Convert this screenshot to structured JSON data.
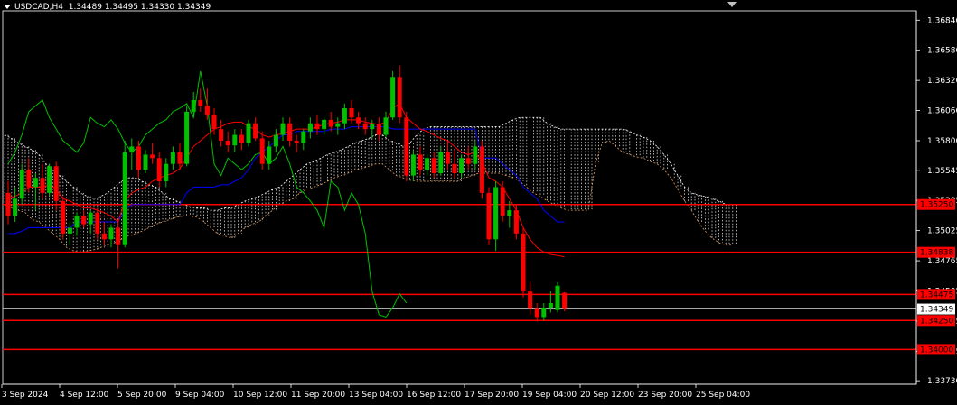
{
  "chart_data": {
    "type": "candlestick",
    "symbol": "USDCAD",
    "timeframe": "H4",
    "ohlc_header": {
      "open": "1.34489",
      "high": "1.34495",
      "low": "1.34330",
      "close": "1.34349"
    },
    "current_price": "1.34349",
    "y_ticks": [
      "1.36840",
      "1.36580",
      "1.36320",
      "1.36060",
      "1.35800",
      "1.35545",
      "1.35285",
      "1.35025",
      "1.34765",
      "1.34505",
      "1.34245",
      "1.33985",
      "1.33730"
    ],
    "ylim": [
      1.337,
      1.3692
    ],
    "x_ticks": [
      "3 Sep 2024",
      "4 Sep 12:00",
      "5 Sep 20:00",
      "9 Sep 04:00",
      "10 Sep 12:00",
      "11 Sep 20:00",
      "13 Sep 04:00",
      "16 Sep 12:00",
      "17 Sep 20:00",
      "19 Sep 04:00",
      "20 Sep 12:00",
      "23 Sep 20:00",
      "25 Sep 04:00"
    ],
    "horizontal_levels": [
      {
        "value": 1.3525,
        "label": "1.35250",
        "color": "#ff0000"
      },
      {
        "value": 1.34838,
        "label": "1.34838",
        "color": "#ff0000"
      },
      {
        "value": 1.34475,
        "label": "1.34475",
        "color": "#ff0000"
      },
      {
        "value": 1.3425,
        "label": "1.34250",
        "color": "#ff0000"
      },
      {
        "value": 1.34,
        "label": "1.34000",
        "color": "#ff0000"
      }
    ],
    "colors": {
      "bull": "#00c000",
      "bear": "#ff0000",
      "tenkan": "#ff0000",
      "kijun": "#0000ff",
      "chikou": "#00c000",
      "cloud_a": "#ffffff",
      "cloud_b": "#e39b5b",
      "grid_axis": "#ffffff"
    },
    "candles": [
      [
        1.3535,
        1.3545,
        1.3508,
        1.3515
      ],
      [
        1.3515,
        1.354,
        1.351,
        1.353
      ],
      [
        1.353,
        1.356,
        1.3525,
        1.3555
      ],
      [
        1.3555,
        1.3565,
        1.3535,
        1.354
      ],
      [
        1.354,
        1.3552,
        1.352,
        1.3548
      ],
      [
        1.3548,
        1.356,
        1.353,
        1.3535
      ],
      [
        1.3535,
        1.356,
        1.3532,
        1.3558
      ],
      [
        1.3558,
        1.3562,
        1.352,
        1.3528
      ],
      [
        1.3528,
        1.3532,
        1.3495,
        1.35
      ],
      [
        1.35,
        1.351,
        1.349,
        1.3505
      ],
      [
        1.3505,
        1.3518,
        1.3498,
        1.3515
      ],
      [
        1.3515,
        1.352,
        1.3505,
        1.3508
      ],
      [
        1.3508,
        1.352,
        1.35,
        1.3518
      ],
      [
        1.3518,
        1.3522,
        1.3495,
        1.35
      ],
      [
        1.35,
        1.351,
        1.349,
        1.3495
      ],
      [
        1.3495,
        1.3508,
        1.3488,
        1.3505
      ],
      [
        1.3505,
        1.3512,
        1.347,
        1.349
      ],
      [
        1.349,
        1.358,
        1.3488,
        1.357
      ],
      [
        1.357,
        1.3582,
        1.3555,
        1.3575
      ],
      [
        1.3575,
        1.358,
        1.3548,
        1.3555
      ],
      [
        1.3555,
        1.3572,
        1.3552,
        1.3568
      ],
      [
        1.3568,
        1.3578,
        1.356,
        1.3565
      ],
      [
        1.3565,
        1.357,
        1.354,
        1.3545
      ],
      [
        1.3545,
        1.3565,
        1.354,
        1.356
      ],
      [
        1.356,
        1.3575,
        1.3555,
        1.357
      ],
      [
        1.357,
        1.3578,
        1.3555,
        1.356
      ],
      [
        1.356,
        1.361,
        1.3558,
        1.3605
      ],
      [
        1.3605,
        1.3622,
        1.36,
        1.3615
      ],
      [
        1.3615,
        1.3625,
        1.3605,
        1.361
      ],
      [
        1.361,
        1.3625,
        1.3598,
        1.3602
      ],
      [
        1.3602,
        1.3608,
        1.3585,
        1.359
      ],
      [
        1.359,
        1.3598,
        1.3575,
        1.358
      ],
      [
        1.358,
        1.3588,
        1.357,
        1.3576
      ],
      [
        1.3576,
        1.359,
        1.357,
        1.3585
      ],
      [
        1.3585,
        1.359,
        1.3572,
        1.3578
      ],
      [
        1.3578,
        1.3598,
        1.3575,
        1.3595
      ],
      [
        1.3595,
        1.36,
        1.358,
        1.3582
      ],
      [
        1.3582,
        1.3588,
        1.3555,
        1.356
      ],
      [
        1.356,
        1.358,
        1.3555,
        1.3575
      ],
      [
        1.3575,
        1.359,
        1.357,
        1.3585
      ],
      [
        1.3585,
        1.36,
        1.358,
        1.3595
      ],
      [
        1.3595,
        1.36,
        1.3575,
        1.358
      ],
      [
        1.358,
        1.3585,
        1.357,
        1.3578
      ],
      [
        1.3578,
        1.359,
        1.3572,
        1.3588
      ],
      [
        1.3588,
        1.36,
        1.3582,
        1.3595
      ],
      [
        1.3595,
        1.3602,
        1.3585,
        1.359
      ],
      [
        1.359,
        1.36,
        1.3585,
        1.3598
      ],
      [
        1.3598,
        1.3605,
        1.3588,
        1.3592
      ],
      [
        1.3592,
        1.36,
        1.3585,
        1.3595
      ],
      [
        1.3595,
        1.3612,
        1.359,
        1.3608
      ],
      [
        1.3608,
        1.3615,
        1.3595,
        1.36
      ],
      [
        1.36,
        1.3605,
        1.359,
        1.3595
      ],
      [
        1.3595,
        1.36,
        1.3585,
        1.359
      ],
      [
        1.359,
        1.3598,
        1.3582,
        1.3594
      ],
      [
        1.3594,
        1.36,
        1.358,
        1.3585
      ],
      [
        1.3585,
        1.3605,
        1.3583,
        1.36
      ],
      [
        1.36,
        1.364,
        1.3598,
        1.3635
      ],
      [
        1.3635,
        1.3645,
        1.3595,
        1.36
      ],
      [
        1.36,
        1.3605,
        1.3545,
        1.355
      ],
      [
        1.355,
        1.3572,
        1.3545,
        1.3568
      ],
      [
        1.3568,
        1.3575,
        1.355,
        1.3555
      ],
      [
        1.3555,
        1.3568,
        1.355,
        1.3565
      ],
      [
        1.3565,
        1.357,
        1.3548,
        1.3552
      ],
      [
        1.3552,
        1.3575,
        1.355,
        1.357
      ],
      [
        1.357,
        1.358,
        1.3555,
        1.356
      ],
      [
        1.356,
        1.3572,
        1.3548,
        1.3552
      ],
      [
        1.3552,
        1.3568,
        1.3548,
        1.3565
      ],
      [
        1.3565,
        1.3575,
        1.3555,
        1.356
      ],
      [
        1.356,
        1.358,
        1.3555,
        1.3575
      ],
      [
        1.3575,
        1.358,
        1.353,
        1.3535
      ],
      [
        1.3535,
        1.354,
        1.349,
        1.3495
      ],
      [
        1.3495,
        1.3545,
        1.3485,
        1.354
      ],
      [
        1.354,
        1.3545,
        1.351,
        1.3515
      ],
      [
        1.3515,
        1.3528,
        1.3505,
        1.352
      ],
      [
        1.352,
        1.3525,
        1.3495,
        1.35
      ],
      [
        1.35,
        1.3505,
        1.3445,
        1.345
      ],
      [
        1.345,
        1.3458,
        1.343,
        1.3435
      ],
      [
        1.3435,
        1.344,
        1.3424,
        1.3428
      ],
      [
        1.3428,
        1.344,
        1.3425,
        1.3436
      ],
      [
        1.3436,
        1.345,
        1.3432,
        1.344
      ],
      [
        1.3434,
        1.3458,
        1.3432,
        1.3455
      ],
      [
        1.34489,
        1.34495,
        1.3433,
        1.34349
      ]
    ],
    "tenkan": [
      1.353,
      1.3532,
      1.3535,
      1.354,
      1.354,
      1.354,
      1.3542,
      1.3538,
      1.353,
      1.3528,
      1.3525,
      1.3522,
      1.3522,
      1.352,
      1.3518,
      1.3515,
      1.351,
      1.3528,
      1.3535,
      1.3538,
      1.354,
      1.3545,
      1.3548,
      1.355,
      1.3552,
      1.3556,
      1.3565,
      1.3575,
      1.358,
      1.3585,
      1.359,
      1.3592,
      1.3595,
      1.3596,
      1.3596,
      1.3592,
      1.359,
      1.3585,
      1.3583,
      1.3585,
      1.3586,
      1.3588,
      1.359,
      1.359,
      1.359,
      1.3592,
      1.3594,
      1.3595,
      1.3596,
      1.3598,
      1.3598,
      1.3598,
      1.3596,
      1.3595,
      1.3594,
      1.3596,
      1.3608,
      1.3612,
      1.36,
      1.3595,
      1.359,
      1.3588,
      1.3585,
      1.3582,
      1.358,
      1.3575,
      1.357,
      1.3568,
      1.357,
      1.3562,
      1.3548,
      1.3545,
      1.354,
      1.353,
      1.352,
      1.3505,
      1.3495,
      1.3488,
      1.3484,
      1.3482,
      1.3481,
      1.348
    ],
    "kijun": [
      1.35,
      1.35,
      1.3502,
      1.3505,
      1.3505,
      1.3505,
      1.3505,
      1.3505,
      1.3505,
      1.3505,
      1.351,
      1.351,
      1.351,
      1.351,
      1.351,
      1.351,
      1.351,
      1.352,
      1.3525,
      1.3525,
      1.3525,
      1.3525,
      1.3525,
      1.3525,
      1.3525,
      1.3525,
      1.3535,
      1.354,
      1.354,
      1.354,
      1.354,
      1.3542,
      1.3542,
      1.3545,
      1.3548,
      1.3555,
      1.3565,
      1.357,
      1.3575,
      1.358,
      1.3585,
      1.3585,
      1.3588,
      1.3588,
      1.3588,
      1.3588,
      1.3588,
      1.359,
      1.359,
      1.359,
      1.3592,
      1.3592,
      1.3592,
      1.3592,
      1.3592,
      1.3592,
      1.359,
      1.359,
      1.359,
      1.359,
      1.359,
      1.359,
      1.359,
      1.359,
      1.359,
      1.359,
      1.359,
      1.359,
      1.359,
      1.3565,
      1.3565,
      1.3565,
      1.356,
      1.3555,
      1.355,
      1.354,
      1.3535,
      1.353,
      1.352,
      1.3515,
      1.351,
      1.351
    ],
    "chikou": [
      1.356,
      1.357,
      1.3585,
      1.3605,
      1.361,
      1.3615,
      1.36,
      1.359,
      1.358,
      1.3575,
      1.357,
      1.3578,
      1.36,
      1.3595,
      1.3592,
      1.3598,
      1.359,
      1.3578,
      1.357,
      1.3575,
      1.3585,
      1.359,
      1.3595,
      1.3598,
      1.3605,
      1.3608,
      1.3612,
      1.36,
      1.364,
      1.361,
      1.356,
      1.355,
      1.3565,
      1.356,
      1.3555,
      1.356,
      1.3568,
      1.357,
      1.356,
      1.3565,
      1.3575,
      1.356,
      1.354,
      1.3535,
      1.3528,
      1.352,
      1.3505,
      1.3545,
      1.354,
      1.352,
      1.3535,
      1.3525,
      1.35,
      1.345,
      1.343,
      1.3428,
      1.3436,
      1.3448,
      1.344
    ],
    "cloud": [
      [
        1.3585,
        1.3525
      ],
      [
        1.3582,
        1.3522
      ],
      [
        1.3578,
        1.352
      ],
      [
        1.3575,
        1.3518
      ],
      [
        1.3572,
        1.3512
      ],
      [
        1.3568,
        1.351
      ],
      [
        1.356,
        1.3505
      ],
      [
        1.3555,
        1.35
      ],
      [
        1.355,
        1.3495
      ],
      [
        1.3545,
        1.3488
      ],
      [
        1.354,
        1.3485
      ],
      [
        1.3535,
        1.3484
      ],
      [
        1.3532,
        1.3485
      ],
      [
        1.353,
        1.3486
      ],
      [
        1.3532,
        1.3488
      ],
      [
        1.3535,
        1.349
      ],
      [
        1.354,
        1.3492
      ],
      [
        1.3545,
        1.3495
      ],
      [
        1.3548,
        1.3498
      ],
      [
        1.3548,
        1.35
      ],
      [
        1.3545,
        1.3502
      ],
      [
        1.3542,
        1.3505
      ],
      [
        1.354,
        1.3508
      ],
      [
        1.3535,
        1.351
      ],
      [
        1.353,
        1.3512
      ],
      [
        1.3528,
        1.3514
      ],
      [
        1.3525,
        1.3515
      ],
      [
        1.3523,
        1.3515
      ],
      [
        1.3522,
        1.3514
      ],
      [
        1.3522,
        1.351
      ],
      [
        1.352,
        1.3505
      ],
      [
        1.352,
        1.35
      ],
      [
        1.3522,
        1.3498
      ],
      [
        1.3522,
        1.3496
      ],
      [
        1.3525,
        1.35
      ],
      [
        1.3528,
        1.3505
      ],
      [
        1.353,
        1.3508
      ],
      [
        1.3532,
        1.351
      ],
      [
        1.3535,
        1.3515
      ],
      [
        1.3538,
        1.352
      ],
      [
        1.354,
        1.3525
      ],
      [
        1.3545,
        1.3528
      ],
      [
        1.355,
        1.353
      ],
      [
        1.3555,
        1.3535
      ],
      [
        1.356,
        1.3538
      ],
      [
        1.3562,
        1.354
      ],
      [
        1.3565,
        1.3542
      ],
      [
        1.3568,
        1.3545
      ],
      [
        1.357,
        1.3548
      ],
      [
        1.3572,
        1.355
      ],
      [
        1.3575,
        1.3552
      ],
      [
        1.3578,
        1.3555
      ],
      [
        1.358,
        1.3556
      ],
      [
        1.3582,
        1.3558
      ],
      [
        1.3585,
        1.356
      ],
      [
        1.3585,
        1.356
      ],
      [
        1.358,
        1.3555
      ],
      [
        1.3578,
        1.355
      ],
      [
        1.3575,
        1.3548
      ],
      [
        1.3578,
        1.3546
      ],
      [
        1.3585,
        1.3545
      ],
      [
        1.359,
        1.3545
      ],
      [
        1.3592,
        1.3545
      ],
      [
        1.3592,
        1.3545
      ],
      [
        1.3592,
        1.3545
      ],
      [
        1.3592,
        1.3545
      ],
      [
        1.3592,
        1.3545
      ],
      [
        1.3592,
        1.3548
      ],
      [
        1.3592,
        1.355
      ],
      [
        1.3592,
        1.3552
      ],
      [
        1.3592,
        1.3552
      ],
      [
        1.3592,
        1.3552
      ],
      [
        1.3592,
        1.3552
      ],
      [
        1.3595,
        1.355
      ],
      [
        1.3598,
        1.3548
      ],
      [
        1.36,
        1.3545
      ],
      [
        1.36,
        1.354
      ],
      [
        1.36,
        1.3535
      ],
      [
        1.36,
        1.3532
      ],
      [
        1.3595,
        1.3528
      ],
      [
        1.3592,
        1.3525
      ],
      [
        1.359,
        1.3522
      ],
      [
        1.359,
        1.352
      ],
      [
        1.359,
        1.352
      ],
      [
        1.359,
        1.352
      ],
      [
        1.359,
        1.352
      ],
      [
        1.359,
        1.356
      ],
      [
        1.359,
        1.3578
      ],
      [
        1.359,
        1.358
      ],
      [
        1.359,
        1.3575
      ],
      [
        1.359,
        1.357
      ],
      [
        1.3588,
        1.3568
      ],
      [
        1.3585,
        1.3566
      ],
      [
        1.3583,
        1.3565
      ],
      [
        1.358,
        1.3562
      ],
      [
        1.3575,
        1.356
      ],
      [
        1.3568,
        1.3555
      ],
      [
        1.356,
        1.3548
      ],
      [
        1.355,
        1.3538
      ],
      [
        1.354,
        1.3528
      ],
      [
        1.3535,
        1.352
      ],
      [
        1.3533,
        1.351
      ],
      [
        1.3532,
        1.3502
      ],
      [
        1.353,
        1.3496
      ],
      [
        1.3528,
        1.3492
      ],
      [
        1.3525,
        1.349
      ],
      [
        1.3525,
        1.349
      ]
    ]
  }
}
